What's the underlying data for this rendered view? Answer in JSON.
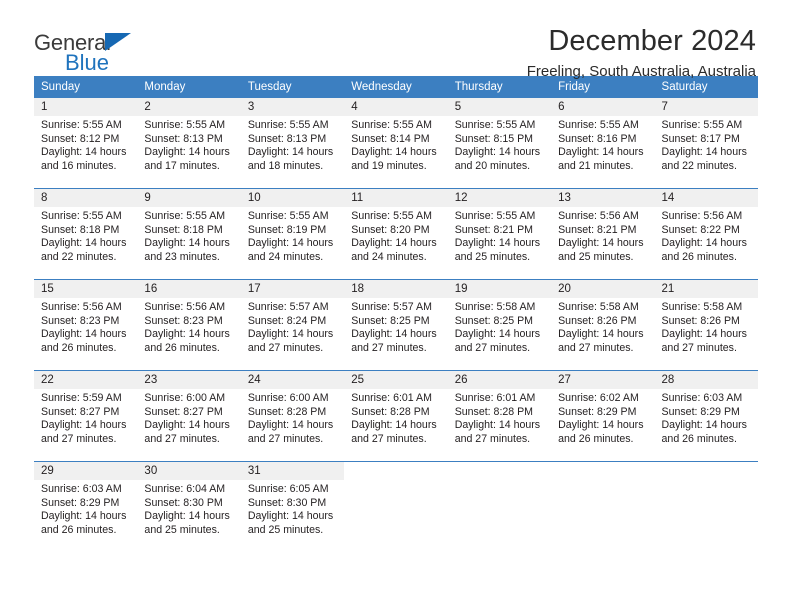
{
  "brand": {
    "name_part1": "General",
    "name_part2": "Blue",
    "flag_icon": "blue-flag-triangle"
  },
  "header": {
    "title": "December 2024",
    "subtitle": "Freeling, South Australia, Australia"
  },
  "colors": {
    "header_blue": "#3c7fc1",
    "brand_blue": "#1668b3",
    "daynum_bg": "#f0f0f0",
    "text": "#231f20"
  },
  "weekday_headers": [
    "Sunday",
    "Monday",
    "Tuesday",
    "Wednesday",
    "Thursday",
    "Friday",
    "Saturday"
  ],
  "weeks": [
    [
      {
        "day": "1",
        "sunrise": "Sunrise: 5:55 AM",
        "sunset": "Sunset: 8:12 PM",
        "daylight1": "Daylight: 14 hours",
        "daylight2": "and 16 minutes."
      },
      {
        "day": "2",
        "sunrise": "Sunrise: 5:55 AM",
        "sunset": "Sunset: 8:13 PM",
        "daylight1": "Daylight: 14 hours",
        "daylight2": "and 17 minutes."
      },
      {
        "day": "3",
        "sunrise": "Sunrise: 5:55 AM",
        "sunset": "Sunset: 8:13 PM",
        "daylight1": "Daylight: 14 hours",
        "daylight2": "and 18 minutes."
      },
      {
        "day": "4",
        "sunrise": "Sunrise: 5:55 AM",
        "sunset": "Sunset: 8:14 PM",
        "daylight1": "Daylight: 14 hours",
        "daylight2": "and 19 minutes."
      },
      {
        "day": "5",
        "sunrise": "Sunrise: 5:55 AM",
        "sunset": "Sunset: 8:15 PM",
        "daylight1": "Daylight: 14 hours",
        "daylight2": "and 20 minutes."
      },
      {
        "day": "6",
        "sunrise": "Sunrise: 5:55 AM",
        "sunset": "Sunset: 8:16 PM",
        "daylight1": "Daylight: 14 hours",
        "daylight2": "and 21 minutes."
      },
      {
        "day": "7",
        "sunrise": "Sunrise: 5:55 AM",
        "sunset": "Sunset: 8:17 PM",
        "daylight1": "Daylight: 14 hours",
        "daylight2": "and 22 minutes."
      }
    ],
    [
      {
        "day": "8",
        "sunrise": "Sunrise: 5:55 AM",
        "sunset": "Sunset: 8:18 PM",
        "daylight1": "Daylight: 14 hours",
        "daylight2": "and 22 minutes."
      },
      {
        "day": "9",
        "sunrise": "Sunrise: 5:55 AM",
        "sunset": "Sunset: 8:18 PM",
        "daylight1": "Daylight: 14 hours",
        "daylight2": "and 23 minutes."
      },
      {
        "day": "10",
        "sunrise": "Sunrise: 5:55 AM",
        "sunset": "Sunset: 8:19 PM",
        "daylight1": "Daylight: 14 hours",
        "daylight2": "and 24 minutes."
      },
      {
        "day": "11",
        "sunrise": "Sunrise: 5:55 AM",
        "sunset": "Sunset: 8:20 PM",
        "daylight1": "Daylight: 14 hours",
        "daylight2": "and 24 minutes."
      },
      {
        "day": "12",
        "sunrise": "Sunrise: 5:55 AM",
        "sunset": "Sunset: 8:21 PM",
        "daylight1": "Daylight: 14 hours",
        "daylight2": "and 25 minutes."
      },
      {
        "day": "13",
        "sunrise": "Sunrise: 5:56 AM",
        "sunset": "Sunset: 8:21 PM",
        "daylight1": "Daylight: 14 hours",
        "daylight2": "and 25 minutes."
      },
      {
        "day": "14",
        "sunrise": "Sunrise: 5:56 AM",
        "sunset": "Sunset: 8:22 PM",
        "daylight1": "Daylight: 14 hours",
        "daylight2": "and 26 minutes."
      }
    ],
    [
      {
        "day": "15",
        "sunrise": "Sunrise: 5:56 AM",
        "sunset": "Sunset: 8:23 PM",
        "daylight1": "Daylight: 14 hours",
        "daylight2": "and 26 minutes."
      },
      {
        "day": "16",
        "sunrise": "Sunrise: 5:56 AM",
        "sunset": "Sunset: 8:23 PM",
        "daylight1": "Daylight: 14 hours",
        "daylight2": "and 26 minutes."
      },
      {
        "day": "17",
        "sunrise": "Sunrise: 5:57 AM",
        "sunset": "Sunset: 8:24 PM",
        "daylight1": "Daylight: 14 hours",
        "daylight2": "and 27 minutes."
      },
      {
        "day": "18",
        "sunrise": "Sunrise: 5:57 AM",
        "sunset": "Sunset: 8:25 PM",
        "daylight1": "Daylight: 14 hours",
        "daylight2": "and 27 minutes."
      },
      {
        "day": "19",
        "sunrise": "Sunrise: 5:58 AM",
        "sunset": "Sunset: 8:25 PM",
        "daylight1": "Daylight: 14 hours",
        "daylight2": "and 27 minutes."
      },
      {
        "day": "20",
        "sunrise": "Sunrise: 5:58 AM",
        "sunset": "Sunset: 8:26 PM",
        "daylight1": "Daylight: 14 hours",
        "daylight2": "and 27 minutes."
      },
      {
        "day": "21",
        "sunrise": "Sunrise: 5:58 AM",
        "sunset": "Sunset: 8:26 PM",
        "daylight1": "Daylight: 14 hours",
        "daylight2": "and 27 minutes."
      }
    ],
    [
      {
        "day": "22",
        "sunrise": "Sunrise: 5:59 AM",
        "sunset": "Sunset: 8:27 PM",
        "daylight1": "Daylight: 14 hours",
        "daylight2": "and 27 minutes."
      },
      {
        "day": "23",
        "sunrise": "Sunrise: 6:00 AM",
        "sunset": "Sunset: 8:27 PM",
        "daylight1": "Daylight: 14 hours",
        "daylight2": "and 27 minutes."
      },
      {
        "day": "24",
        "sunrise": "Sunrise: 6:00 AM",
        "sunset": "Sunset: 8:28 PM",
        "daylight1": "Daylight: 14 hours",
        "daylight2": "and 27 minutes."
      },
      {
        "day": "25",
        "sunrise": "Sunrise: 6:01 AM",
        "sunset": "Sunset: 8:28 PM",
        "daylight1": "Daylight: 14 hours",
        "daylight2": "and 27 minutes."
      },
      {
        "day": "26",
        "sunrise": "Sunrise: 6:01 AM",
        "sunset": "Sunset: 8:28 PM",
        "daylight1": "Daylight: 14 hours",
        "daylight2": "and 27 minutes."
      },
      {
        "day": "27",
        "sunrise": "Sunrise: 6:02 AM",
        "sunset": "Sunset: 8:29 PM",
        "daylight1": "Daylight: 14 hours",
        "daylight2": "and 26 minutes."
      },
      {
        "day": "28",
        "sunrise": "Sunrise: 6:03 AM",
        "sunset": "Sunset: 8:29 PM",
        "daylight1": "Daylight: 14 hours",
        "daylight2": "and 26 minutes."
      }
    ],
    [
      {
        "day": "29",
        "sunrise": "Sunrise: 6:03 AM",
        "sunset": "Sunset: 8:29 PM",
        "daylight1": "Daylight: 14 hours",
        "daylight2": "and 26 minutes."
      },
      {
        "day": "30",
        "sunrise": "Sunrise: 6:04 AM",
        "sunset": "Sunset: 8:30 PM",
        "daylight1": "Daylight: 14 hours",
        "daylight2": "and 25 minutes."
      },
      {
        "day": "31",
        "sunrise": "Sunrise: 6:05 AM",
        "sunset": "Sunset: 8:30 PM",
        "daylight1": "Daylight: 14 hours",
        "daylight2": "and 25 minutes."
      },
      {
        "day": "",
        "sunrise": "",
        "sunset": "",
        "daylight1": "",
        "daylight2": ""
      },
      {
        "day": "",
        "sunrise": "",
        "sunset": "",
        "daylight1": "",
        "daylight2": ""
      },
      {
        "day": "",
        "sunrise": "",
        "sunset": "",
        "daylight1": "",
        "daylight2": ""
      },
      {
        "day": "",
        "sunrise": "",
        "sunset": "",
        "daylight1": "",
        "daylight2": ""
      }
    ]
  ]
}
